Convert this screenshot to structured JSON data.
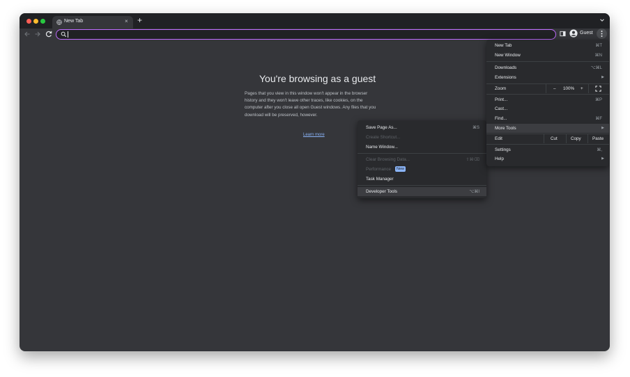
{
  "tab": {
    "title": "New Tab",
    "close": "×"
  },
  "newtab": "+",
  "profile": {
    "label": "Guest"
  },
  "omnibox": {
    "value": "",
    "placeholder": ""
  },
  "content": {
    "title": "You're browsing as a guest",
    "body_lines": [
      "Pages that you view in this window won't appear in the browser",
      "history and they won't leave other traces, like cookies, on the",
      "computer after you close all open Guest windows. Any files that you",
      "download will be preserved, however."
    ],
    "learn_more": "Learn more"
  },
  "main_menu": {
    "new_tab": {
      "label": "New Tab",
      "shortcut": "⌘T"
    },
    "new_window": {
      "label": "New Window",
      "shortcut": "⌘N"
    },
    "downloads": {
      "label": "Downloads",
      "shortcut": "⌥⌘L"
    },
    "extensions": {
      "label": "Extensions"
    },
    "zoom": {
      "label": "Zoom",
      "minus": "–",
      "value": "100%",
      "plus": "+"
    },
    "print": {
      "label": "Print...",
      "shortcut": "⌘P"
    },
    "cast": {
      "label": "Cast..."
    },
    "find": {
      "label": "Find...",
      "shortcut": "⌘F"
    },
    "more_tools": {
      "label": "More Tools"
    },
    "edit": {
      "label": "Edit",
      "cut": "Cut",
      "copy": "Copy",
      "paste": "Paste"
    },
    "settings": {
      "label": "Settings",
      "shortcut": "⌘,"
    },
    "help": {
      "label": "Help"
    }
  },
  "sub_menu": {
    "save_page": {
      "label": "Save Page As...",
      "shortcut": "⌘S"
    },
    "create_shortcut": {
      "label": "Create Shortcut..."
    },
    "name_window": {
      "label": "Name Window..."
    },
    "clear_browsing": {
      "label": "Clear Browsing Data...",
      "shortcut": "⇧⌘⌫"
    },
    "performance": {
      "label": "Performance",
      "badge": "New"
    },
    "task_manager": {
      "label": "Task Manager"
    },
    "developer_tools": {
      "label": "Developer Tools",
      "shortcut": "⌥⌘I"
    }
  },
  "colors": {
    "frame": "#202124",
    "toolbar": "#35363a",
    "menu": "#292a2d",
    "omnibox_border": "#c06cff",
    "link": "#8ab4f8"
  }
}
